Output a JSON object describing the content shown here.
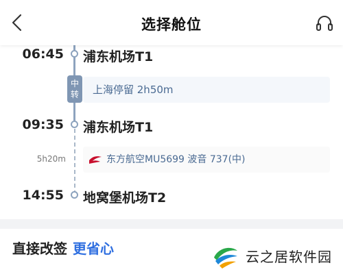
{
  "header": {
    "title": "选择舱位",
    "back_icon": "chevron-left-icon",
    "service_icon": "headphones-icon"
  },
  "timeline": {
    "segments": [
      {
        "time": "06:45",
        "station": "浦东机场T1"
      },
      {
        "time": "09:35",
        "station": "浦东机场T1"
      },
      {
        "time": "14:55",
        "station": "地窝堡机场T2"
      }
    ],
    "transfer": {
      "badge": "中转",
      "stop_text": "上海停留 2h50m"
    },
    "flight": {
      "duration": "5h20m",
      "airline_icon": "china-eastern-logo-icon",
      "text": "东方航空MU5699 波音 737(中)"
    }
  },
  "promo": {
    "label": "直接改签",
    "accent": "更省心"
  },
  "watermark": {
    "text": "云之居软件园"
  },
  "colors": {
    "accent_blue": "#2f6fe0",
    "timeline": "#8da3be",
    "stop_text": "#4a6a92",
    "airline_red": "#c8102e"
  }
}
